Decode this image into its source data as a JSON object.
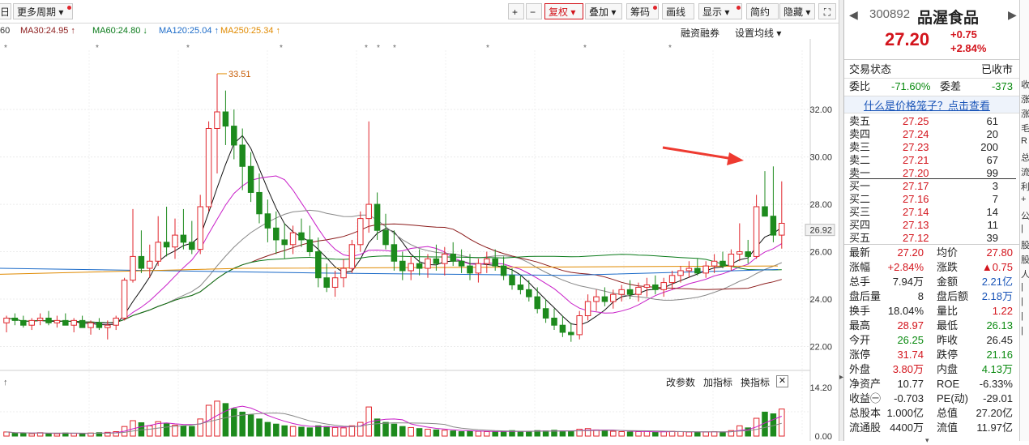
{
  "toolbar": {
    "period_fragment": "日",
    "more_period": "更多周期",
    "right_buttons": [
      "+",
      "−",
      "复权",
      "叠加",
      "筹码",
      "画线",
      "显示",
      "简约",
      "隐藏"
    ]
  },
  "ma_legend": [
    {
      "text": "60",
      "color": "#333"
    },
    {
      "text": "MA30:24.95 ↑",
      "color": "#8b1a1a"
    },
    {
      "text": "MA60:24.80 ↓",
      "color": "#0a7a1a"
    },
    {
      "text": "MA120:25.04 ↑",
      "color": "#1a6ac8"
    },
    {
      "text": "MA250:25.34 ↑",
      "color": "#e08a00"
    }
  ],
  "chart_tools": {
    "margin": "融资融券",
    "ma_setting": "设置均线"
  },
  "price_axis": [
    "32.00",
    "30.00",
    "28.00",
    "26.92",
    "26.00",
    "24.00",
    "22.00"
  ],
  "peak_label": "33.51",
  "volume_tools": {
    "params": "改参数",
    "add": "加指标",
    "switch": "换指标"
  },
  "volume_axis": [
    "14.20",
    "0.00"
  ],
  "chart_data": {
    "type": "candlestick",
    "ylim": [
      21.3,
      34.5
    ],
    "volume_ylim": [
      0,
      14.2
    ],
    "candles": [
      [
        23.0,
        23.3,
        22.6,
        23.2,
        1.2
      ],
      [
        23.2,
        23.4,
        22.9,
        23.1,
        0.8
      ],
      [
        23.1,
        23.3,
        22.8,
        22.9,
        0.9
      ],
      [
        22.9,
        23.2,
        22.7,
        23.1,
        0.7
      ],
      [
        23.1,
        23.4,
        22.9,
        23.2,
        1.0
      ],
      [
        23.2,
        23.5,
        22.9,
        23.0,
        0.8
      ],
      [
        23.0,
        23.3,
        22.8,
        23.1,
        0.7
      ],
      [
        23.1,
        23.4,
        22.9,
        22.9,
        0.9
      ],
      [
        22.9,
        23.2,
        22.6,
        23.1,
        0.8
      ],
      [
        23.1,
        23.3,
        22.9,
        22.8,
        0.7
      ],
      [
        22.8,
        23.1,
        22.5,
        23.0,
        0.9
      ],
      [
        23.0,
        23.2,
        22.7,
        22.8,
        1.0
      ],
      [
        22.8,
        23.1,
        22.3,
        22.9,
        1.1
      ],
      [
        22.9,
        23.3,
        22.7,
        23.2,
        1.3
      ],
      [
        23.2,
        24.9,
        23.1,
        24.8,
        2.8
      ],
      [
        24.8,
        27.8,
        24.7,
        25.8,
        4.5
      ],
      [
        25.8,
        26.9,
        25.1,
        25.3,
        3.9
      ],
      [
        25.3,
        26.3,
        24.9,
        25.6,
        3.0
      ],
      [
        25.6,
        27.5,
        25.4,
        26.4,
        4.2
      ],
      [
        26.4,
        27.9,
        25.8,
        26.2,
        3.6
      ],
      [
        26.2,
        27.4,
        25.7,
        26.7,
        3.2
      ],
      [
        26.7,
        27.8,
        26.1,
        26.4,
        3.0
      ],
      [
        26.4,
        27.3,
        25.9,
        26.1,
        2.8
      ],
      [
        26.1,
        28.4,
        25.9,
        27.9,
        5.0
      ],
      [
        27.9,
        31.5,
        27.7,
        31.2,
        9.0
      ],
      [
        31.2,
        33.51,
        29.3,
        31.9,
        10.2
      ],
      [
        31.9,
        32.8,
        30.5,
        31.3,
        9.5
      ],
      [
        31.3,
        32.0,
        29.9,
        30.5,
        8.0
      ],
      [
        30.5,
        31.2,
        28.6,
        29.6,
        7.0
      ],
      [
        29.6,
        30.2,
        28.1,
        28.5,
        6.2
      ],
      [
        28.5,
        29.3,
        27.2,
        27.6,
        5.0
      ],
      [
        27.6,
        28.2,
        26.4,
        27.0,
        4.0
      ],
      [
        27.0,
        27.7,
        25.9,
        26.5,
        3.5
      ],
      [
        26.5,
        27.2,
        25.7,
        26.3,
        3.0
      ],
      [
        26.3,
        27.1,
        25.9,
        26.8,
        2.8
      ],
      [
        26.8,
        27.4,
        26.2,
        26.5,
        2.6
      ],
      [
        26.5,
        27.1,
        25.8,
        26.0,
        2.4
      ],
      [
        26.0,
        26.6,
        24.5,
        24.9,
        3.0
      ],
      [
        24.9,
        25.5,
        24.3,
        24.5,
        2.8
      ],
      [
        24.5,
        25.2,
        24.1,
        24.9,
        2.5
      ],
      [
        24.9,
        25.7,
        24.5,
        25.3,
        2.4
      ],
      [
        25.3,
        26.5,
        25.1,
        26.3,
        3.0
      ],
      [
        26.3,
        27.7,
        26.0,
        27.4,
        4.0
      ],
      [
        27.4,
        31.5,
        26.8,
        28.0,
        8.5
      ],
      [
        28.0,
        28.5,
        26.5,
        26.9,
        5.0
      ],
      [
        26.9,
        27.6,
        26.1,
        26.3,
        4.0
      ],
      [
        26.3,
        26.9,
        25.2,
        25.6,
        3.5
      ],
      [
        25.6,
        26.0,
        24.8,
        25.2,
        2.8
      ],
      [
        25.2,
        25.8,
        24.8,
        25.5,
        2.5
      ],
      [
        25.5,
        26.1,
        25.0,
        25.3,
        2.2
      ],
      [
        25.3,
        25.9,
        24.9,
        25.7,
        2.0
      ],
      [
        25.7,
        26.3,
        25.2,
        25.5,
        1.8
      ],
      [
        25.5,
        26.2,
        25.0,
        25.9,
        1.7
      ],
      [
        25.9,
        26.4,
        25.4,
        25.6,
        1.5
      ],
      [
        25.6,
        26.1,
        25.1,
        25.4,
        1.3
      ],
      [
        25.4,
        25.9,
        24.8,
        25.1,
        1.5
      ],
      [
        25.1,
        25.7,
        24.7,
        25.5,
        1.4
      ],
      [
        25.5,
        26.0,
        25.1,
        25.7,
        1.3
      ],
      [
        25.7,
        26.1,
        25.2,
        25.4,
        1.2
      ],
      [
        25.4,
        25.8,
        24.8,
        25.0,
        1.4
      ],
      [
        25.0,
        25.3,
        24.4,
        24.6,
        1.6
      ],
      [
        24.6,
        25.0,
        24.2,
        24.4,
        1.3
      ],
      [
        24.4,
        24.8,
        23.9,
        24.1,
        1.4
      ],
      [
        24.1,
        24.5,
        23.4,
        23.6,
        1.6
      ],
      [
        23.6,
        24.0,
        23.0,
        23.2,
        1.5
      ],
      [
        23.2,
        23.6,
        22.7,
        22.9,
        1.7
      ],
      [
        22.9,
        23.3,
        22.4,
        22.6,
        1.5
      ],
      [
        22.6,
        23.0,
        22.2,
        22.5,
        1.4
      ],
      [
        22.5,
        23.5,
        22.3,
        23.3,
        2.0
      ],
      [
        23.3,
        24.2,
        23.1,
        23.9,
        2.2
      ],
      [
        23.9,
        24.4,
        23.5,
        24.1,
        1.8
      ],
      [
        24.1,
        24.5,
        23.7,
        23.9,
        1.5
      ],
      [
        23.9,
        24.4,
        23.6,
        24.2,
        1.4
      ],
      [
        24.2,
        24.6,
        23.9,
        24.4,
        1.3
      ],
      [
        24.4,
        24.8,
        24.0,
        24.2,
        1.2
      ],
      [
        24.2,
        24.7,
        23.9,
        24.5,
        1.3
      ],
      [
        24.5,
        24.9,
        24.1,
        24.6,
        1.4
      ],
      [
        24.6,
        25.0,
        24.2,
        24.4,
        1.1
      ],
      [
        24.4,
        24.9,
        24.1,
        24.7,
        1.3
      ],
      [
        24.7,
        25.2,
        24.4,
        25.0,
        1.4
      ],
      [
        25.0,
        25.4,
        24.7,
        25.2,
        1.3
      ],
      [
        25.2,
        25.6,
        24.9,
        25.3,
        1.2
      ],
      [
        25.3,
        25.7,
        25.0,
        25.1,
        1.1
      ],
      [
        25.1,
        25.6,
        24.9,
        25.4,
        1.2
      ],
      [
        25.4,
        25.9,
        25.1,
        25.6,
        1.3
      ],
      [
        25.6,
        26.0,
        25.3,
        25.4,
        1.2
      ],
      [
        25.4,
        26.1,
        25.2,
        25.9,
        1.6
      ],
      [
        25.9,
        27.2,
        25.6,
        26.0,
        3.0
      ],
      [
        26.0,
        26.5,
        25.5,
        25.8,
        2.4
      ],
      [
        25.8,
        28.4,
        25.7,
        27.9,
        5.2
      ],
      [
        27.9,
        29.4,
        27.5,
        27.5,
        7.0
      ],
      [
        27.5,
        29.6,
        26.4,
        26.7,
        6.5
      ],
      [
        26.7,
        28.97,
        26.13,
        27.2,
        7.9
      ]
    ]
  },
  "panel": {
    "code": "300892",
    "name": "品渥食品",
    "price": "27.20",
    "change": "+0.75",
    "change_pct": "+2.84%",
    "status_label": "交易状态",
    "status_value": "已收市",
    "weibi_label": "委比",
    "weibi_value": "-71.60%",
    "weicha_label": "委差",
    "weicha_value": "-373",
    "link": "什么是价格笼子？点击查看",
    "asks": [
      {
        "label": "卖五",
        "price": "27.25",
        "vol": "61"
      },
      {
        "label": "卖四",
        "price": "27.24",
        "vol": "20"
      },
      {
        "label": "卖三",
        "price": "27.23",
        "vol": "200"
      },
      {
        "label": "卖二",
        "price": "27.21",
        "vol": "67"
      },
      {
        "label": "卖一",
        "price": "27.20",
        "vol": "99"
      }
    ],
    "bids": [
      {
        "label": "买一",
        "price": "27.17",
        "vol": "3"
      },
      {
        "label": "买二",
        "price": "27.16",
        "vol": "7"
      },
      {
        "label": "买三",
        "price": "27.14",
        "vol": "14"
      },
      {
        "label": "买四",
        "price": "27.13",
        "vol": "11"
      },
      {
        "label": "买五",
        "price": "27.12",
        "vol": "39"
      }
    ],
    "stats": [
      {
        "l1": "最新",
        "v1": "27.20",
        "c1": "red",
        "l2": "均价",
        "v2": "27.80",
        "c2": "red"
      },
      {
        "l1": "涨幅",
        "v1": "+2.84%",
        "c1": "red",
        "l2": "涨跌",
        "v2": "▲0.75",
        "c2": "red"
      },
      {
        "l1": "总手",
        "v1": "7.94万",
        "c1": "",
        "l2": "金额",
        "v2": "2.21亿",
        "c2": "blue"
      },
      {
        "l1": "盘后量",
        "v1": "8",
        "c1": "",
        "l2": "盘后额",
        "v2": "2.18万",
        "c2": "blue"
      },
      {
        "l1": "换手",
        "v1": "18.04%",
        "c1": "",
        "l2": "量比",
        "v2": "1.22",
        "c2": "red"
      },
      {
        "l1": "最高",
        "v1": "28.97",
        "c1": "red",
        "l2": "最低",
        "v2": "26.13",
        "c2": "grn"
      },
      {
        "l1": "今开",
        "v1": "26.25",
        "c1": "grn",
        "l2": "昨收",
        "v2": "26.45",
        "c2": ""
      },
      {
        "l1": "涨停",
        "v1": "31.74",
        "c1": "red",
        "l2": "跌停",
        "v2": "21.16",
        "c2": "grn"
      },
      {
        "l1": "外盘",
        "v1": "3.80万",
        "c1": "red",
        "l2": "内盘",
        "v2": "4.13万",
        "c2": "grn"
      },
      {
        "l1": "净资产",
        "v1": "10.77",
        "c1": "",
        "l2": "ROE",
        "v2": "-6.33%",
        "c2": ""
      },
      {
        "l1": "收益㊀",
        "v1": "-0.703",
        "c1": "",
        "l2": "PE(动)",
        "v2": "-29.01",
        "c2": ""
      },
      {
        "l1": "总股本",
        "v1": "1.000亿",
        "c1": "",
        "l2": "总值",
        "v2": "27.20亿",
        "c2": ""
      },
      {
        "l1": "流通股",
        "v1": "4400万",
        "c1": "",
        "l2": "流值",
        "v2": "11.97亿",
        "c2": ""
      }
    ]
  },
  "edge_chars": [
    "收",
    "涨",
    "涨",
    "毛",
    "R",
    "总",
    "流",
    "利",
    "+",
    "公",
    "|",
    "股",
    "股",
    "人",
    "|",
    "|",
    "|",
    "|"
  ]
}
